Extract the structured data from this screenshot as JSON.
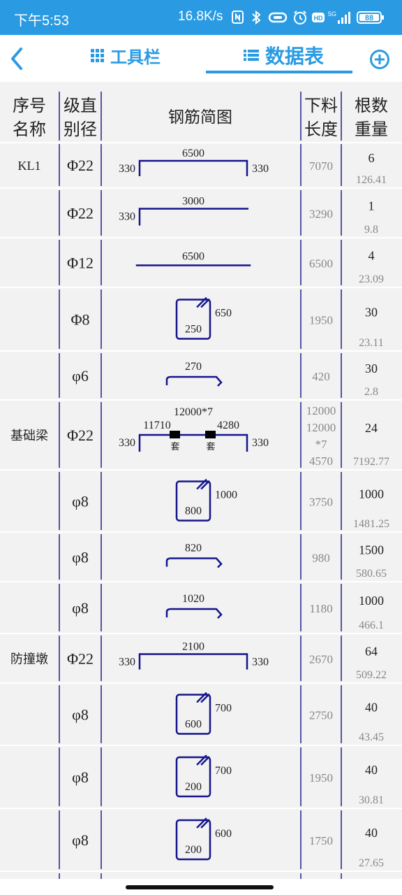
{
  "status_bar": {
    "time": "下午5:53",
    "speed": "16.8K/s",
    "battery": "88",
    "network": "5G"
  },
  "app_bar": {
    "tabs": [
      {
        "label": "工具栏",
        "icon": "grid-icon",
        "selected": false
      },
      {
        "label": "数据表",
        "icon": "list-icon",
        "selected": true
      }
    ],
    "accent": "#2a9be3"
  },
  "table": {
    "headers": {
      "name": [
        "序号",
        "名称"
      ],
      "grade": [
        "级直",
        "别径"
      ],
      "sketch": "钢筋简图",
      "length": [
        "下料",
        "长度"
      ],
      "count": [
        "根数",
        "重量"
      ]
    },
    "rows": [
      {
        "name": "KL1",
        "grade_symbol": "Φ",
        "diameter": "22",
        "length": [
          "7070"
        ],
        "count": "6",
        "weight": "126.41",
        "sketch": {
          "type": "channel",
          "top": "6500",
          "left": "330",
          "right": "330"
        }
      },
      {
        "name": "",
        "grade_symbol": "Φ",
        "diameter": "22",
        "length": [
          "3290"
        ],
        "count": "1",
        "weight": "9.8",
        "sketch": {
          "type": "hook-left",
          "top": "3000",
          "left": "330"
        }
      },
      {
        "name": "",
        "grade_symbol": "Φ",
        "diameter": "12",
        "length": [
          "6500"
        ],
        "count": "4",
        "weight": "23.09",
        "sketch": {
          "type": "straight",
          "top": "6500"
        }
      },
      {
        "name": "",
        "grade_symbol": "Φ",
        "diameter": "8",
        "length": [
          "1950"
        ],
        "count": "30",
        "weight": "23.11",
        "sketch": {
          "type": "stirrup",
          "width": "250",
          "height": "650"
        }
      },
      {
        "name": "",
        "grade_symbol": "φ",
        "diameter": "6",
        "length": [
          "420"
        ],
        "count": "30",
        "weight": "2.8",
        "sketch": {
          "type": "tie",
          "top": "270"
        }
      },
      {
        "name": "基础梁",
        "grade_symbol": "Φ",
        "diameter": "22",
        "length": [
          "12000",
          "12000",
          "*7",
          "4570"
        ],
        "count": "24",
        "weight": "7192.77",
        "sketch": {
          "type": "spliced",
          "top": "12000*7",
          "left_seg": "11710",
          "right_seg": "4280",
          "left": "330",
          "right": "330",
          "coupler": "套"
        }
      },
      {
        "name": "",
        "grade_symbol": "φ",
        "diameter": "8",
        "length": [
          "3750"
        ],
        "count": "1000",
        "weight": "1481.25",
        "sketch": {
          "type": "stirrup",
          "width": "800",
          "height": "1000"
        }
      },
      {
        "name": "",
        "grade_symbol": "φ",
        "diameter": "8",
        "length": [
          "980"
        ],
        "count": "1500",
        "weight": "580.65",
        "sketch": {
          "type": "tie",
          "top": "820"
        }
      },
      {
        "name": "",
        "grade_symbol": "φ",
        "diameter": "8",
        "length": [
          "1180"
        ],
        "count": "1000",
        "weight": "466.1",
        "sketch": {
          "type": "tie",
          "top": "1020"
        }
      },
      {
        "name": "防撞墩",
        "grade_symbol": "Φ",
        "diameter": "22",
        "length": [
          "2670"
        ],
        "count": "64",
        "weight": "509.22",
        "sketch": {
          "type": "channel",
          "top": "2100",
          "left": "330",
          "right": "330"
        }
      },
      {
        "name": "",
        "grade_symbol": "φ",
        "diameter": "8",
        "length": [
          "2750"
        ],
        "count": "40",
        "weight": "43.45",
        "sketch": {
          "type": "stirrup",
          "width": "600",
          "height": "700"
        }
      },
      {
        "name": "",
        "grade_symbol": "φ",
        "diameter": "8",
        "length": [
          "1950"
        ],
        "count": "40",
        "weight": "30.81",
        "sketch": {
          "type": "stirrup",
          "width": "200",
          "height": "700"
        }
      },
      {
        "name": "",
        "grade_symbol": "φ",
        "diameter": "8",
        "length": [
          "1750"
        ],
        "count": "40",
        "weight": "27.65",
        "sketch": {
          "type": "stirrup",
          "width": "200",
          "height": "600"
        }
      }
    ],
    "colors": {
      "border": "#1f1f8a",
      "text": "#222222",
      "muted": "#888888",
      "rebar": "#15158c"
    }
  }
}
